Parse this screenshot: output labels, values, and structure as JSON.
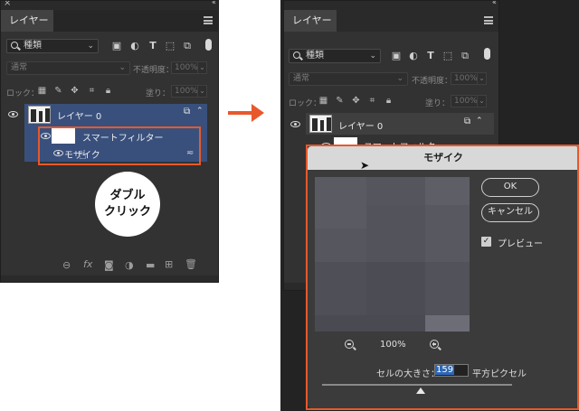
{
  "colors": {
    "accent": "#e8582b",
    "selection": "#39507d",
    "panel": "#323232"
  },
  "left_panel": {
    "close_glyph": "×",
    "collapse_glyph": "‹‹",
    "tab": "レイヤー",
    "filter": {
      "value": "種類",
      "icon": "search-icon"
    },
    "blend_mode": "通常",
    "opacity_label": "不透明度：",
    "opacity_value": "100%",
    "lock_label": "ロック：",
    "fill_label": "塗り：",
    "fill_value": "100%",
    "layer_name": "レイヤー 0",
    "smart_filter_label": "スマートフィルター",
    "filter_name": "モザイク",
    "badge_line1": "ダブル",
    "badge_line2": "クリック"
  },
  "right_panel": {
    "tab": "レイヤー",
    "filter": {
      "value": "種類"
    },
    "blend_mode": "通常",
    "opacity_label": "不透明度：",
    "opacity_value": "100%",
    "lock_label": "ロック：",
    "fill_label": "塗り：",
    "fill_value": "100%",
    "layer_name": "レイヤー 0",
    "smart_filter_label": "スマートフィルター"
  },
  "dialog": {
    "title": "モザイク",
    "ok_label": "OK",
    "cancel_label": "キャンセル",
    "preview_label": "プレビュー",
    "preview_checked": true,
    "zoom_level": "100%",
    "cell_size_label": "セルの大きさ：",
    "cell_size_value": "159",
    "unit_label": "平方ピクセル",
    "cell_size_slider_fraction": 0.52
  }
}
